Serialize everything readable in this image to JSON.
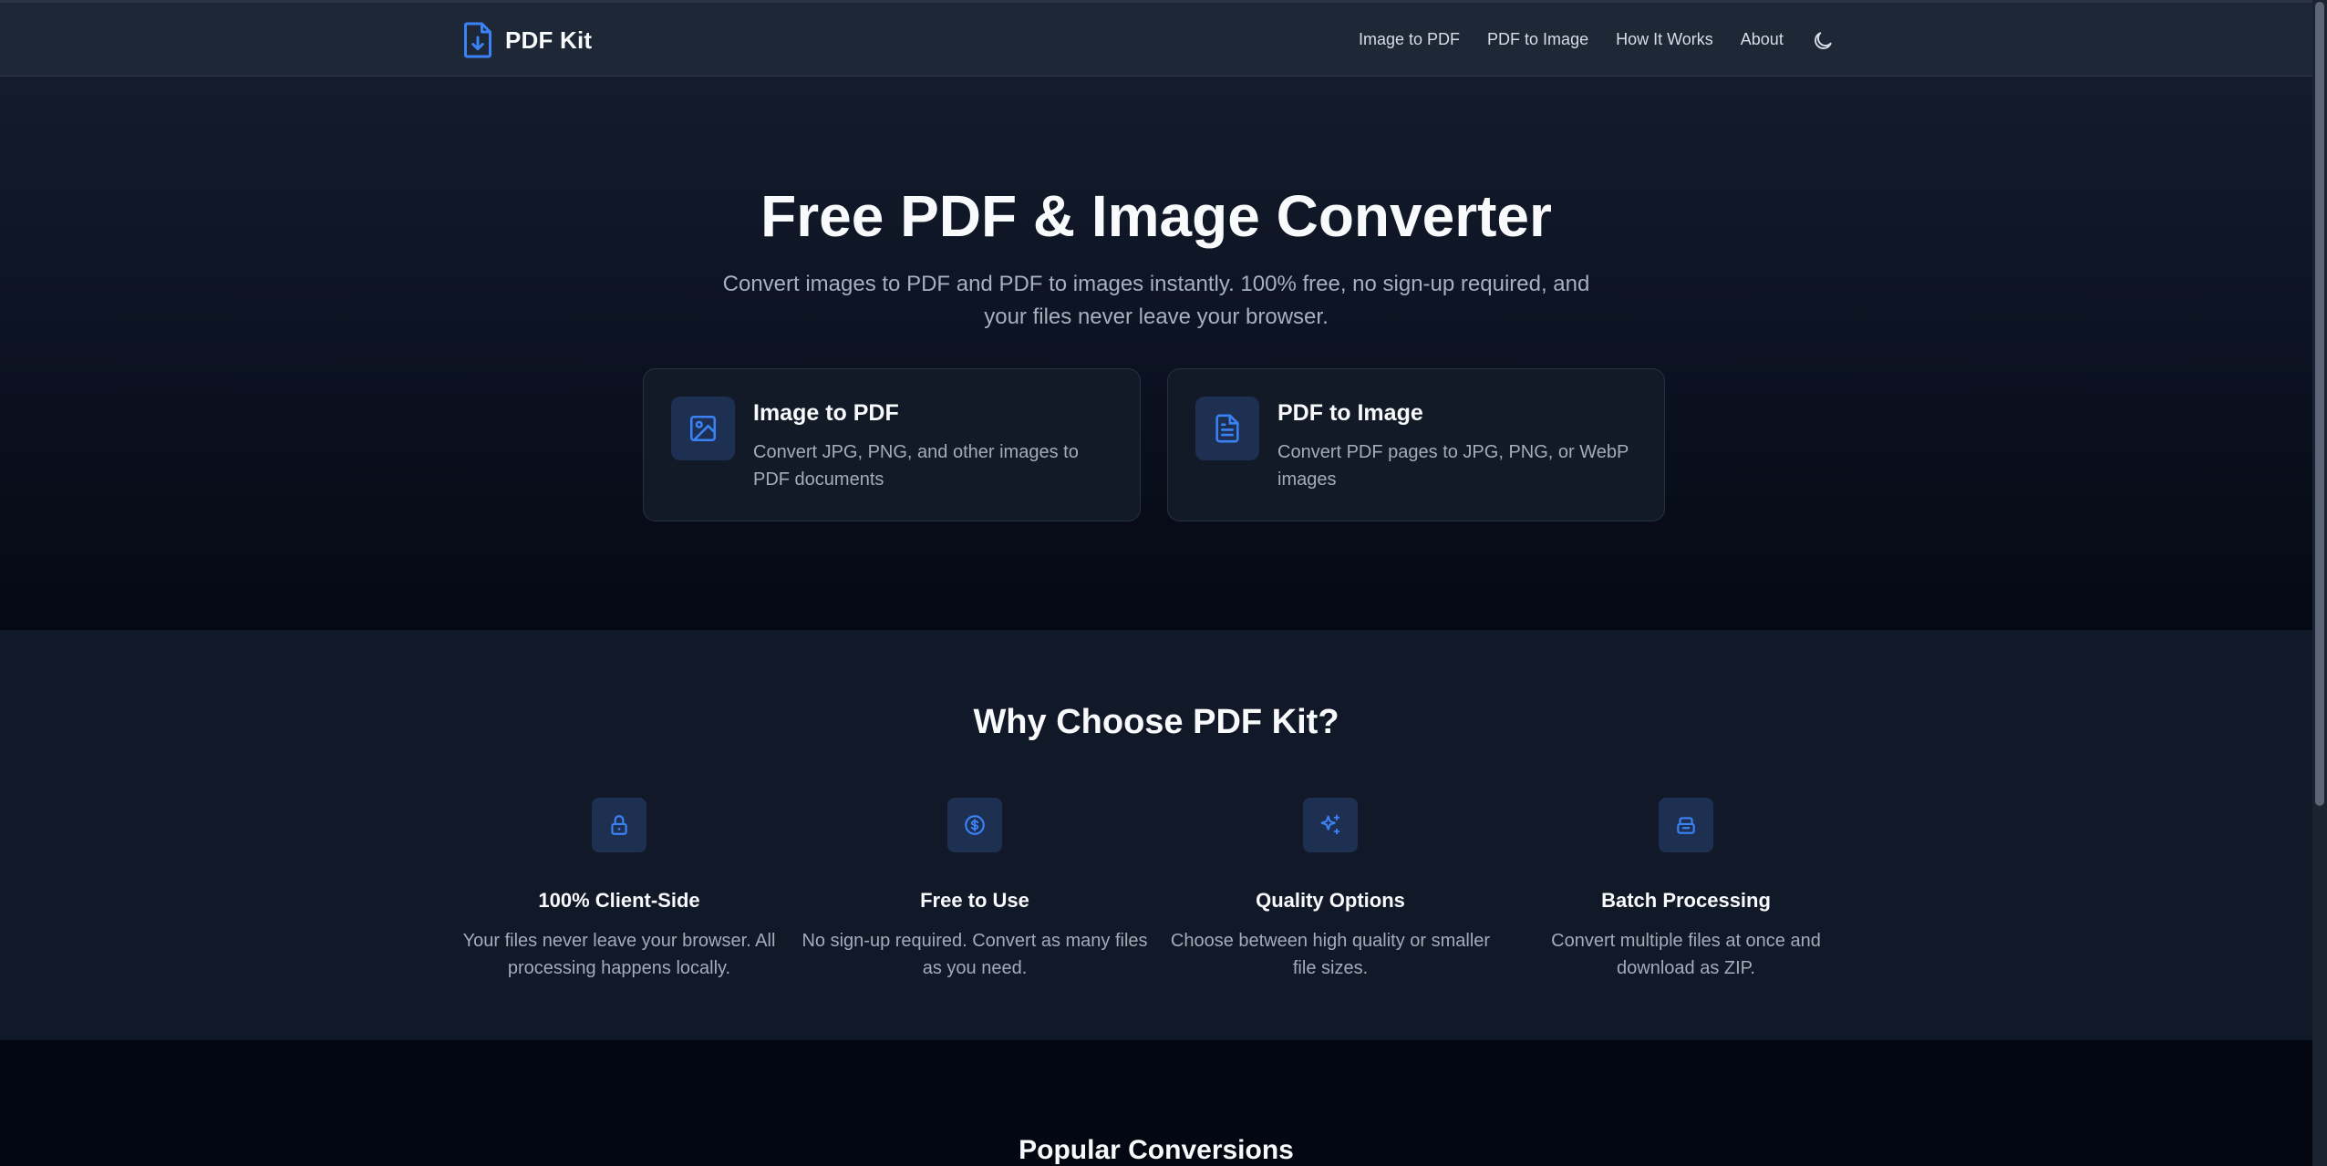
{
  "header": {
    "brand": "PDF Kit",
    "nav": [
      "Image to PDF",
      "PDF to Image",
      "How It Works",
      "About"
    ],
    "theme_icon": "moon-icon"
  },
  "hero": {
    "title": "Free PDF & Image Converter",
    "subtitle": "Convert images to PDF and PDF to images instantly. 100% free, no sign-up required, and your files never leave your browser.",
    "tools": [
      {
        "title": "Image to PDF",
        "description": "Convert JPG, PNG, and other images to PDF documents",
        "icon": "image-icon"
      },
      {
        "title": "PDF to Image",
        "description": "Convert PDF pages to JPG, PNG, or WebP images",
        "icon": "file-text-icon"
      }
    ]
  },
  "features": {
    "title": "Why Choose PDF Kit?",
    "items": [
      {
        "title": "100% Client-Side",
        "description": "Your files never leave your browser. All processing happens locally.",
        "icon": "lock-icon"
      },
      {
        "title": "Free to Use",
        "description": "No sign-up required. Convert as many files as you need.",
        "icon": "dollar-circle-icon"
      },
      {
        "title": "Quality Options",
        "description": "Choose between high quality or smaller file sizes.",
        "icon": "sparkles-icon"
      },
      {
        "title": "Batch Processing",
        "description": "Convert multiple files at once and download as ZIP.",
        "icon": "archive-icon"
      }
    ]
  },
  "popular": {
    "title": "Popular Conversions"
  },
  "colors": {
    "accent": "#3b82f6",
    "icon_tile": "#1d3052",
    "background": "#030712"
  }
}
